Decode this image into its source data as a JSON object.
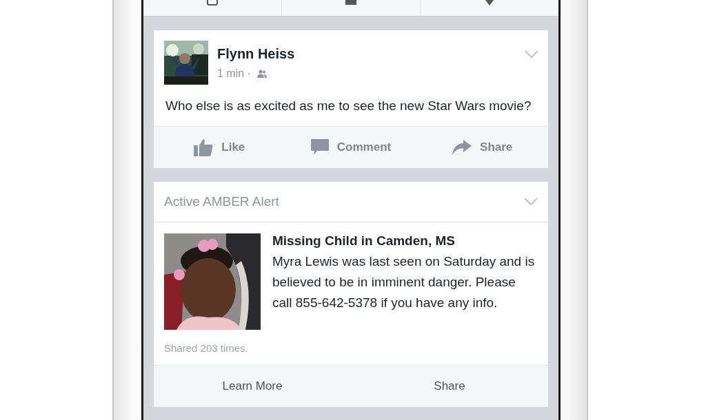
{
  "post": {
    "author": "Flynn Heiss",
    "time": "1 min ·",
    "text": "Who else is as excited as me to see the new Star Wars movie?",
    "actions": [
      {
        "kind": "like",
        "label": "Like"
      },
      {
        "kind": "comment",
        "label": "Comment"
      },
      {
        "kind": "share",
        "label": "Share"
      }
    ]
  },
  "alert": {
    "header": "Active AMBER Alert",
    "title": "Missing Child in Camden, MS",
    "description": "Myra Lewis was last seen on Saturday and is believed to be in imminent danger. Please call 855-642-5378 if you have any info.",
    "shares": "Shared 203 times.",
    "actions": [
      {
        "label": "Learn More"
      },
      {
        "label": "Share"
      }
    ]
  }
}
